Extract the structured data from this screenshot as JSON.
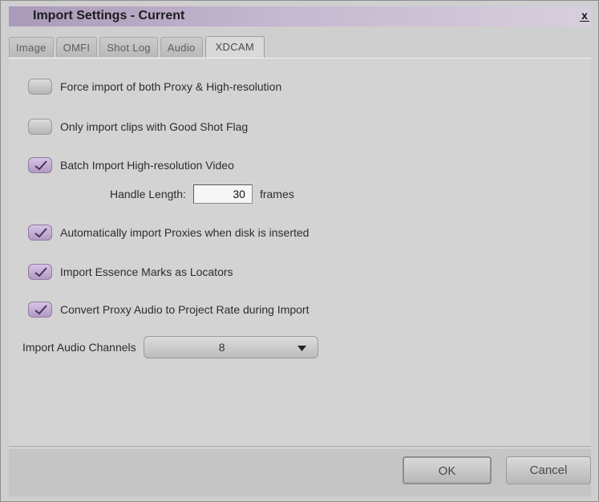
{
  "window": {
    "title": "Import Settings - Current",
    "close_label": "x"
  },
  "tabs": [
    {
      "label": "Image",
      "active": false
    },
    {
      "label": "OMFI",
      "active": false
    },
    {
      "label": "Shot Log",
      "active": false
    },
    {
      "label": "Audio",
      "active": false
    },
    {
      "label": "XDCAM",
      "active": true
    }
  ],
  "options": [
    {
      "label": "Force import of both Proxy & High-resolution",
      "checked": false
    },
    {
      "label": "Only import clips with Good Shot Flag",
      "checked": false
    },
    {
      "label": "Batch Import High-resolution Video",
      "checked": true
    },
    {
      "label": "Automatically import Proxies when disk is inserted",
      "checked": true
    },
    {
      "label": "Import Essence Marks as Locators",
      "checked": true
    },
    {
      "label": "Convert Proxy Audio to Project Rate during Import",
      "checked": true
    }
  ],
  "handle": {
    "label": "Handle Length:",
    "value": "30",
    "unit": "frames"
  },
  "audio_channels": {
    "label": "Import Audio Channels",
    "value": "8"
  },
  "buttons": {
    "ok": "OK",
    "cancel": "Cancel"
  },
  "colors": {
    "title_gradient_start": "#a99ab9",
    "checked_fill": "#c6b1d8"
  }
}
